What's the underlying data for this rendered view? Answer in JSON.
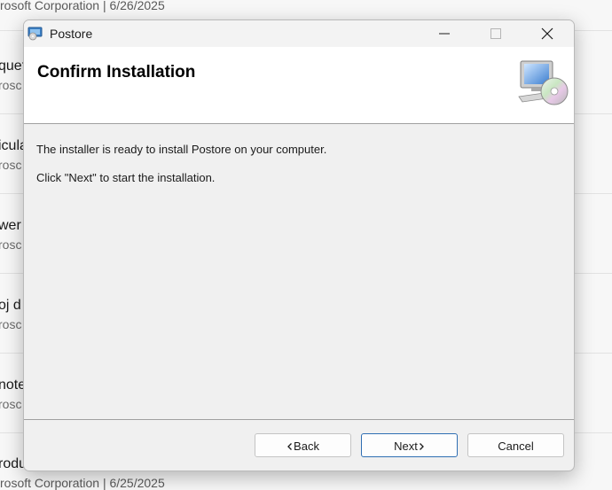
{
  "background": {
    "rows": [
      {
        "title": "",
        "subtitle": "",
        "meta": "rosoft Corporation  |  6/26/2025"
      },
      {
        "title": "quet",
        "subtitle": "rosc"
      },
      {
        "title": "icula",
        "subtitle": "rosc"
      },
      {
        "title": "wer",
        "subtitle": "rosc"
      },
      {
        "title": "oj d",
        "subtitle": "rosc"
      },
      {
        "title": "note",
        "subtitle": "rosc"
      },
      {
        "title": "roduct: Multimedia",
        "subtitle": "",
        "meta": "rosoft Corporation  |  6/25/2025"
      }
    ]
  },
  "window": {
    "title": "Postore",
    "icon": "installer-disc-icon",
    "controls": {
      "minimize": "minimize-icon",
      "maximize": "maximize-icon",
      "close": "close-icon"
    }
  },
  "header": {
    "title": "Confirm Installation",
    "icon": "computer-cd-icon"
  },
  "body": {
    "line1": "The installer is ready to install Postore on your computer.",
    "line2": "Click \"Next\" to start the installation."
  },
  "buttons": {
    "back": "Back",
    "next": "Next",
    "cancel": "Cancel"
  },
  "colors": {
    "accent_border": "#2f6fb3",
    "dialog_bg": "#f0f0f0",
    "header_bg": "#ffffff"
  }
}
